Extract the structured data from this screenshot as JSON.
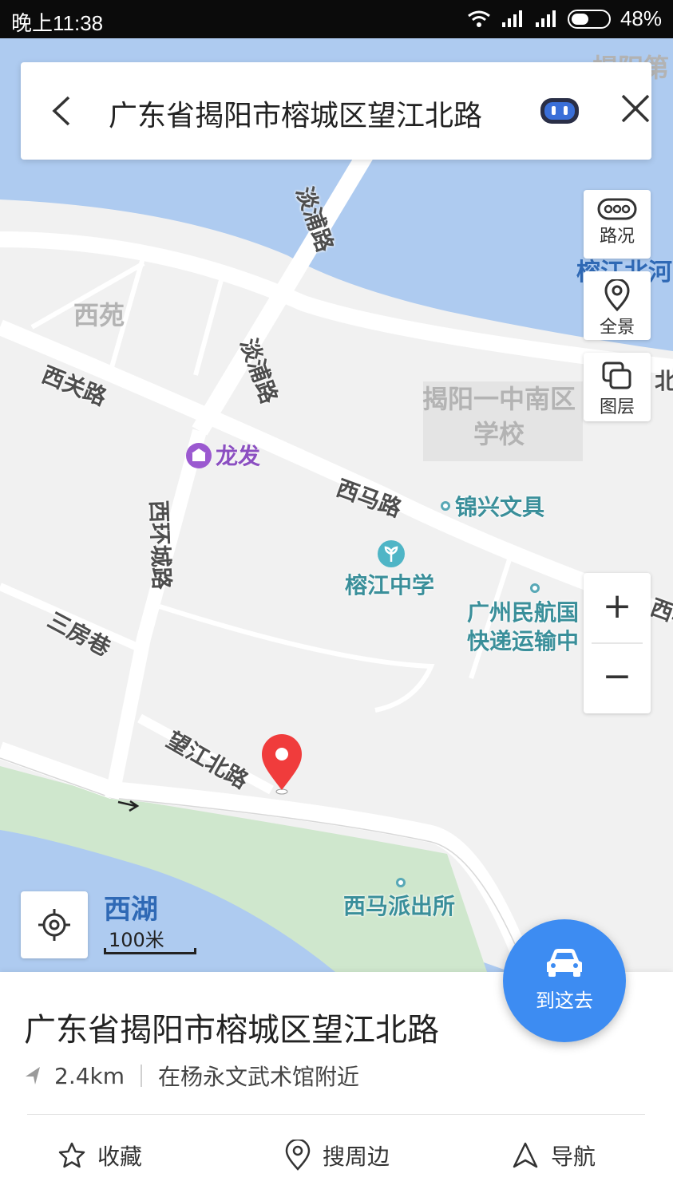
{
  "status_bar": {
    "time": "晚上11:38",
    "battery": "48%",
    "battery_level": 0.48
  },
  "search": {
    "query": "广东省揭阳市榕城区望江北路"
  },
  "map": {
    "roads": {
      "danpu_north": "淡浦路",
      "danpu_south": "淡浦路",
      "xiguan": "西关路",
      "xima": "西马路",
      "xihuancheng": "西环城路",
      "sanfang": "三房巷",
      "wangjiang": "望江北路"
    },
    "areas": {
      "xiyuan": "西苑",
      "school": "揭阳一中南区学校",
      "top_right_fragment": "揭阳第",
      "river_fragment": "榕江北河",
      "north_fragment": "北",
      "xima_fragment": "西马"
    },
    "water": {
      "xihu": "西湖"
    },
    "pois": {
      "longfa": "龙发",
      "jinxing": "锦兴文具",
      "school_name": "榕江中学",
      "express_line1": "广州民航国",
      "express_line2": "快递运输中",
      "police": "西马派出所"
    },
    "scale": "100米"
  },
  "controls": {
    "traffic": "路况",
    "panorama": "全景",
    "layers": "图层",
    "zoom_in": "+",
    "zoom_out": "−"
  },
  "place": {
    "name": "广东省揭阳市榕城区望江北路",
    "distance": "2.4km",
    "nearby": "在杨永文武术馆附近"
  },
  "actions": {
    "favorite": "收藏",
    "search_nearby": "搜周边",
    "navigate": "导航",
    "go_here": "到这去"
  },
  "colors": {
    "water": "#aecbf0",
    "park": "#cfe7cd",
    "accent": "#3d8cf2",
    "pin": "#f03c3c"
  },
  "icons": [
    "back-arrow-icon",
    "robot-icon",
    "close-icon",
    "traffic-icon",
    "panorama-icon",
    "layers-icon",
    "locate-icon",
    "car-icon",
    "star-icon",
    "location-icon",
    "navigation-arrow-icon"
  ]
}
